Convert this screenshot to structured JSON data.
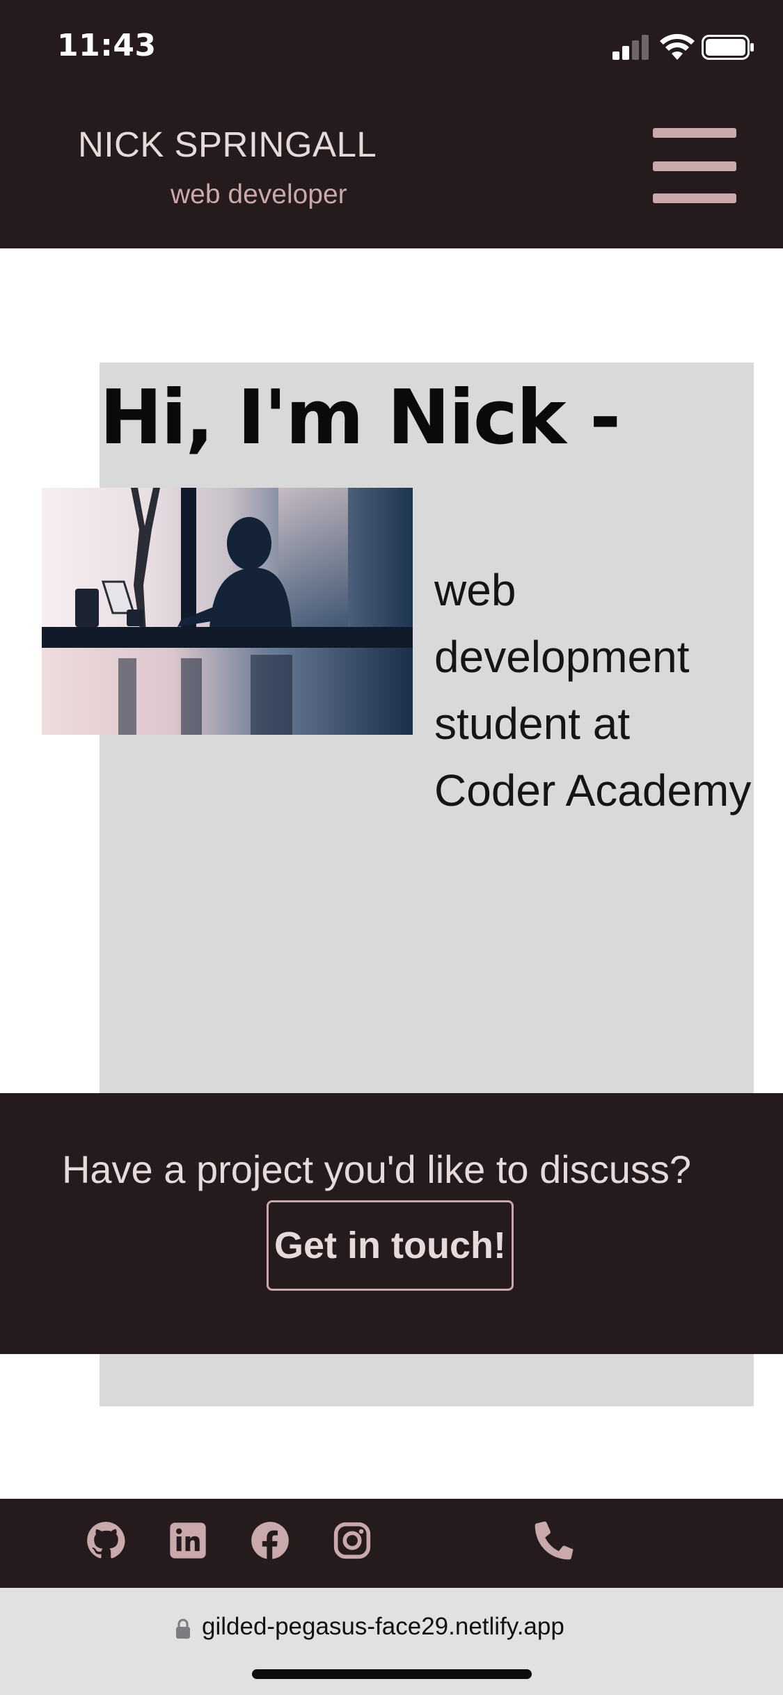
{
  "status_bar": {
    "time": "11:43",
    "icons": [
      "cellular-signal-icon",
      "wifi-icon",
      "battery-icon"
    ]
  },
  "header": {
    "name": "NICK SPRINGALL",
    "subtitle": "web developer",
    "menu_icon": "hamburger-menu-icon"
  },
  "hero": {
    "title": "Hi, I'm Nick -",
    "description_lines": [
      "web",
      "development",
      "student at",
      "Coder Academy"
    ],
    "photo": "person-silhouette-at-cafe-window-photo"
  },
  "cta": {
    "text": "Have a project you'd like to discuss?",
    "button_label": "Get in touch!"
  },
  "footer": {
    "icons": [
      "github-icon",
      "linkedin-icon",
      "facebook-icon",
      "instagram-icon",
      "phone-icon"
    ]
  },
  "browser": {
    "url": "gilded-pegasus-face29.netlify.app",
    "secure_icon": "lock-icon"
  },
  "colors": {
    "dark_bg": "#251b1c",
    "accent_pink": "#c9a9ab",
    "light_text": "#e6dadb",
    "panel_gray": "#d9d9d9",
    "url_bar": "#e1e0e2"
  }
}
